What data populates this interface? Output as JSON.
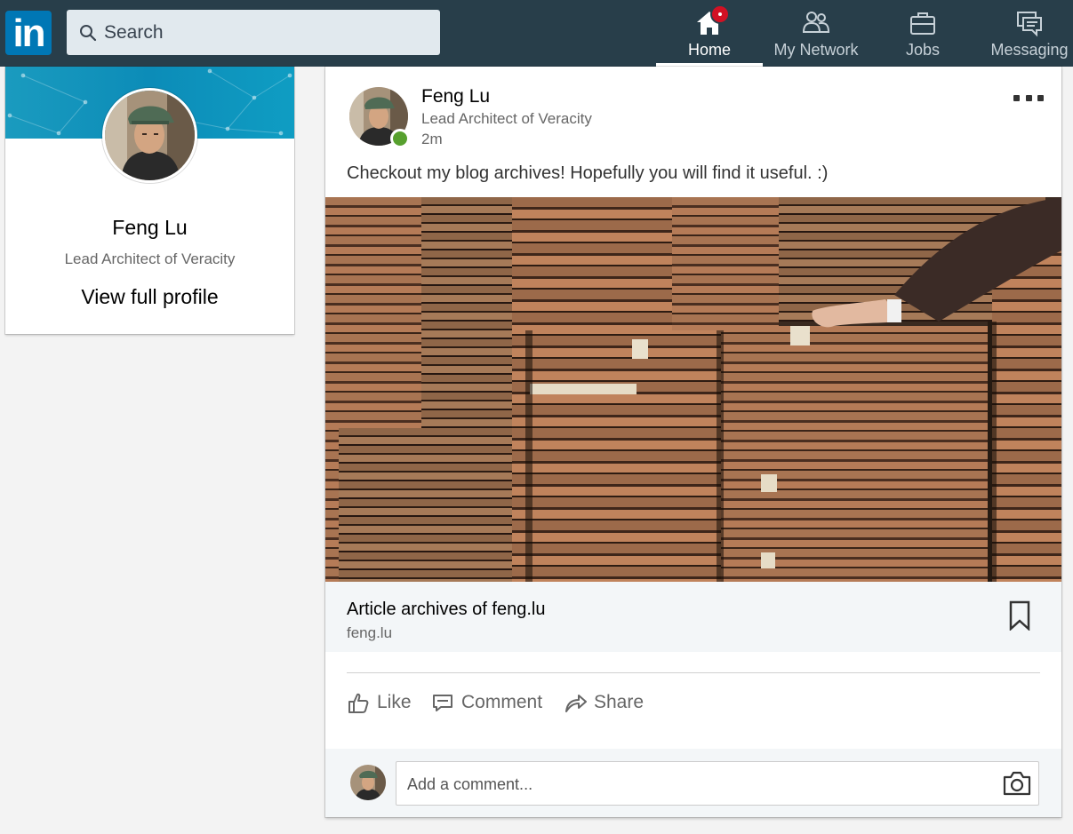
{
  "nav": {
    "logo_text": "in",
    "search_placeholder": "Search",
    "items": [
      {
        "label": "Home",
        "icon": "home-icon",
        "active": true
      },
      {
        "label": "My Network",
        "icon": "network-icon"
      },
      {
        "label": "Jobs",
        "icon": "briefcase-icon"
      },
      {
        "label": "Messaging",
        "icon": "messaging-icon"
      }
    ]
  },
  "profile": {
    "name": "Feng Lu",
    "title": "Lead Architect of Veracity",
    "link": "View full profile"
  },
  "post": {
    "author": "Feng Lu",
    "headline": "Lead Architect of Veracity",
    "time": "2m",
    "text": "Checkout my blog archives! Hopefully you will find it useful. :)",
    "article": {
      "title": "Article archives of feng.lu",
      "domain": "feng.lu"
    },
    "actions": {
      "like": "Like",
      "comment": "Comment",
      "share": "Share"
    },
    "comment_placeholder": "Add a comment..."
  },
  "colors": {
    "nav_bg": "#283e4a",
    "brand": "#0077b5",
    "notification": "#d11124",
    "online": "#57a02e"
  }
}
